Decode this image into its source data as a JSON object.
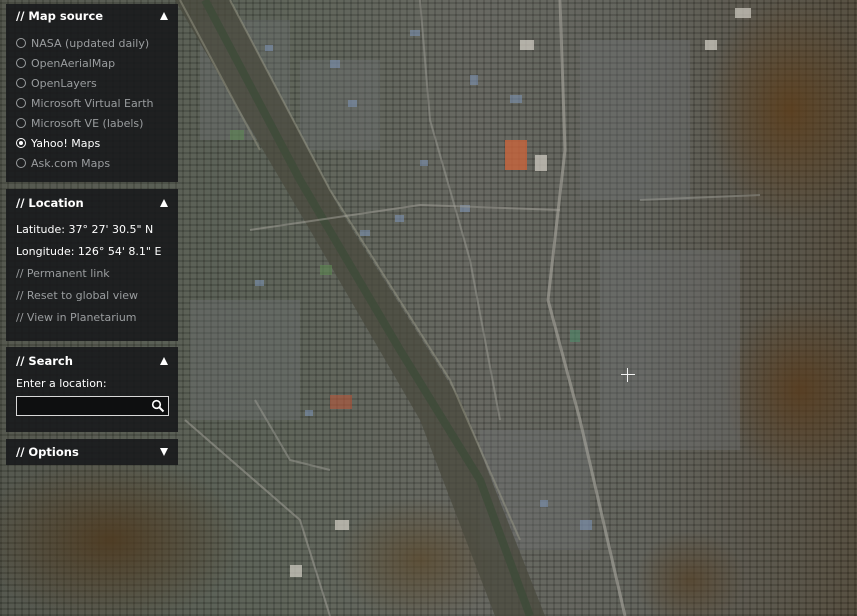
{
  "map_source": {
    "title": "// Map source",
    "collapse_icon": "triangle-up-icon",
    "options": [
      {
        "label": "NASA (updated daily)",
        "selected": false
      },
      {
        "label": "OpenAerialMap",
        "selected": false
      },
      {
        "label": "OpenLayers",
        "selected": false
      },
      {
        "label": "Microsoft Virtual Earth",
        "selected": false
      },
      {
        "label": "Microsoft VE (labels)",
        "selected": false
      },
      {
        "label": "Yahoo! Maps",
        "selected": true
      },
      {
        "label": "Ask.com Maps",
        "selected": false
      }
    ]
  },
  "location": {
    "title": "// Location",
    "collapse_icon": "triangle-up-icon",
    "latitude": "Latitude: 37° 27' 30.5\" N",
    "longitude": "Longitude: 126° 54' 8.1\" E",
    "links": {
      "permanent": "// Permanent link",
      "reset": "// Reset to global view",
      "planetarium": "// View in Planetarium"
    }
  },
  "search": {
    "title": "// Search",
    "collapse_icon": "triangle-up-icon",
    "label": "Enter a location:",
    "value": "",
    "button_icon": "magnifier-icon"
  },
  "options": {
    "title": "// Options",
    "expand_icon": "triangle-down-icon"
  },
  "map": {
    "center_marker_icon": "crosshair-icon"
  }
}
